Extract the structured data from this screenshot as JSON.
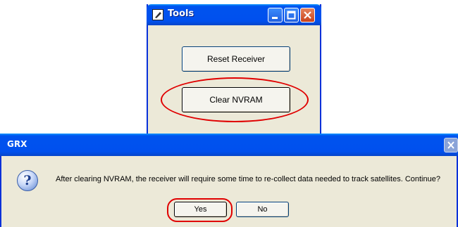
{
  "tools_window": {
    "title": "Tools",
    "reset_receiver_label": "Reset Receiver",
    "clear_nvram_label": "Clear NVRAM"
  },
  "grx_dialog": {
    "title": "GRX",
    "message": "After clearing NVRAM, the receiver will require some time to re-collect data needed to track satellites. Continue?",
    "yes_label": "Yes",
    "no_label": "No",
    "icon": "question-icon"
  },
  "colors": {
    "title_bar": "#0053ee",
    "window_face": "#ece9d8",
    "annotation": "#e00000",
    "close_button": "#c9421c"
  }
}
